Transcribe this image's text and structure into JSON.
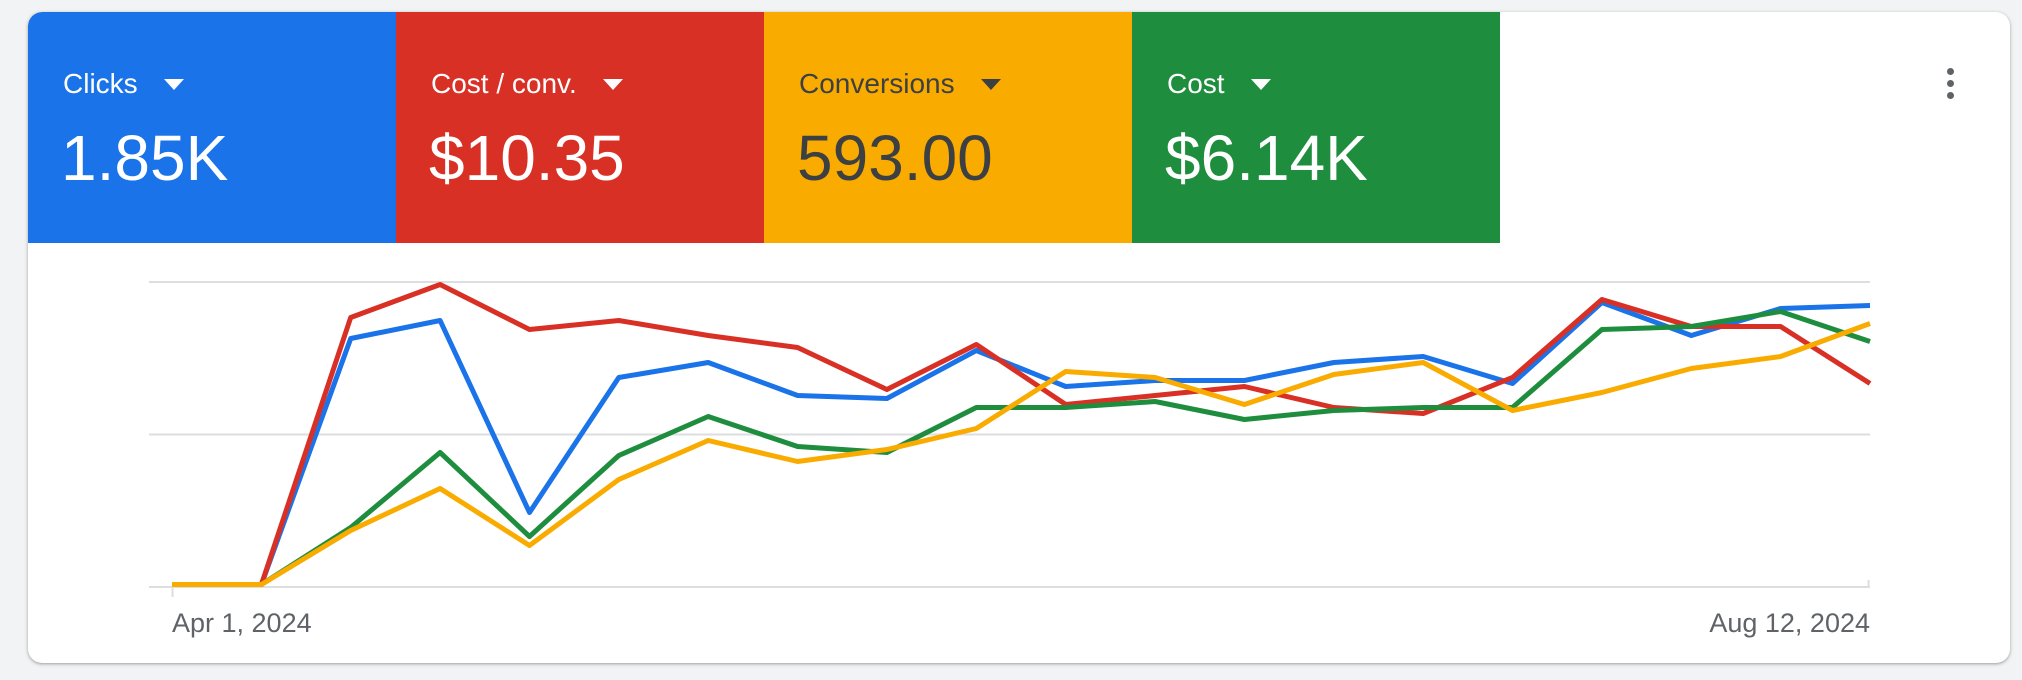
{
  "ui": {
    "more_options_icon": "vertical-ellipsis",
    "colors": {
      "page_background": "#f1f3f4",
      "panel_background": "#ffffff",
      "gridline": "#dcdee0",
      "axis_label_text": "#5f6368",
      "menu_icon": "#5f6368"
    }
  },
  "metric_cards": [
    {
      "id": "clicks",
      "label": "Clicks",
      "value": "1.85K",
      "color": "#1a73e8",
      "text_color": "#ffffff"
    },
    {
      "id": "cost-per-conv",
      "label": "Cost / conv.",
      "value": "$10.35",
      "color": "#d93025",
      "text_color": "#ffffff"
    },
    {
      "id": "conversions",
      "label": "Conversions",
      "value": "593.00",
      "color": "#f9ab00",
      "text_color": "#3c4043"
    },
    {
      "id": "cost",
      "label": "Cost",
      "value": "$6.14K",
      "color": "#1e8e3e",
      "text_color": "#ffffff"
    }
  ],
  "chart_data": {
    "type": "line",
    "title": "",
    "x_axis": {
      "start_label": "Apr 1, 2024",
      "end_label": "Aug 12, 2024",
      "points": 20,
      "granularity": "weekly",
      "tick_labels_visible": [
        "start",
        "end"
      ]
    },
    "y_axis": {
      "min": 0,
      "max": 100,
      "unit": "percent of top gridline (no numeric labels shown)",
      "gridlines": [
        0,
        50,
        100
      ],
      "tick_labels_visible": false
    },
    "grid": "horizontal only",
    "legend_position": "none (series colors match metric cards)",
    "series": [
      {
        "name": "Clicks",
        "color": "#1a73e8",
        "values": [
          0,
          0,
          82,
          88,
          24,
          69,
          74,
          63,
          62,
          78,
          66,
          68,
          68,
          74,
          76,
          67,
          94,
          83,
          92,
          93
        ]
      },
      {
        "name": "Cost / conv.",
        "color": "#d93025",
        "values": [
          0,
          0,
          89,
          100,
          85,
          88,
          83,
          79,
          65,
          80,
          60,
          63,
          66,
          59,
          57,
          69,
          95,
          86,
          86,
          67
        ]
      },
      {
        "name": "Cost",
        "color": "#1e8e3e",
        "values": [
          0,
          0,
          19,
          44,
          16,
          43,
          56,
          46,
          44,
          59,
          59,
          61,
          55,
          58,
          59,
          59,
          85,
          86,
          91,
          81
        ]
      },
      {
        "name": "Conversions",
        "color": "#f9ab00",
        "values": [
          0,
          0,
          18,
          32,
          13,
          35,
          48,
          41,
          45,
          52,
          71,
          69,
          60,
          70,
          74,
          58,
          64,
          72,
          76,
          87
        ]
      }
    ]
  }
}
